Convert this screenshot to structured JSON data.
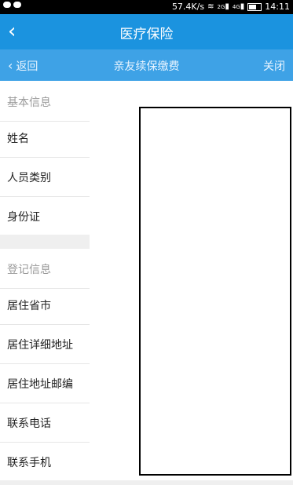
{
  "status_bar": {
    "speed": "57.4K/s",
    "network_1": "2G",
    "network_2": "4G",
    "time": "14:11"
  },
  "titlebar": {
    "title": "医疗保险",
    "back_icon": "back-arrow-icon"
  },
  "subnav": {
    "back_label": "返回",
    "title": "亲友续保缴费",
    "close_label": "关闭"
  },
  "sections": {
    "basic_header": "基本信息",
    "basic_items": [
      "姓名",
      "人员类别",
      "身份证"
    ],
    "register_header": "登记信息",
    "register_items": [
      "居住省市",
      "居住详细地址",
      "居住地址邮编",
      "联系电话",
      "联系手机"
    ]
  },
  "colors": {
    "title_blue": "#1b93df",
    "subnav_blue": "#3ea2e6"
  }
}
